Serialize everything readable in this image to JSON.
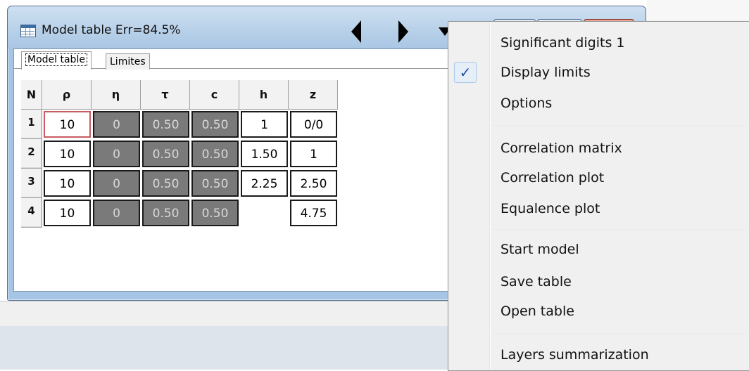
{
  "window": {
    "title": "Model table Err=84.5%"
  },
  "tabs": [
    {
      "label": "Model table",
      "active": true
    },
    {
      "label": "Limites",
      "active": false
    }
  ],
  "table": {
    "headers": [
      "N",
      "ρ",
      "η",
      "τ",
      "c",
      "h",
      "z"
    ],
    "rows": [
      {
        "n": "1",
        "rho": "10",
        "eta": "0",
        "tau": "0.50",
        "c": "0.50",
        "h": "1",
        "z": "0/0"
      },
      {
        "n": "2",
        "rho": "10",
        "eta": "0",
        "tau": "0.50",
        "c": "0.50",
        "h": "1.50",
        "z": "1"
      },
      {
        "n": "3",
        "rho": "10",
        "eta": "0",
        "tau": "0.50",
        "c": "0.50",
        "h": "2.25",
        "z": "2.50"
      },
      {
        "n": "4",
        "rho": "10",
        "eta": "0",
        "tau": "0.50",
        "c": "0.50",
        "h": "",
        "z": "4.75"
      }
    ]
  },
  "context_menu": {
    "items": [
      {
        "label": "Significant digits 1",
        "checked": false
      },
      {
        "label": "Display limits",
        "checked": true,
        "check_glyph": "✓"
      },
      {
        "label": "Options",
        "checked": false
      },
      {
        "label": "Correlation matrix",
        "checked": false
      },
      {
        "label": "Correlation plot",
        "checked": false
      },
      {
        "label": "Equalence plot",
        "checked": false
      },
      {
        "label": "Start model",
        "checked": false
      },
      {
        "label": "Save table",
        "checked": false
      },
      {
        "label": "Open table",
        "checked": false
      },
      {
        "label": "Layers summarization",
        "checked": false
      }
    ]
  },
  "icons": {
    "title": "table-icon",
    "prev": "left-arrow-icon",
    "next": "right-arrow-icon",
    "menu": "down-arrow-icon"
  },
  "colors": {
    "dark_cell": "#7a7a7a",
    "focused_border": "#c85b62",
    "menu_bg": "#f0f0f0",
    "titlebar": "#b7d0e8"
  }
}
